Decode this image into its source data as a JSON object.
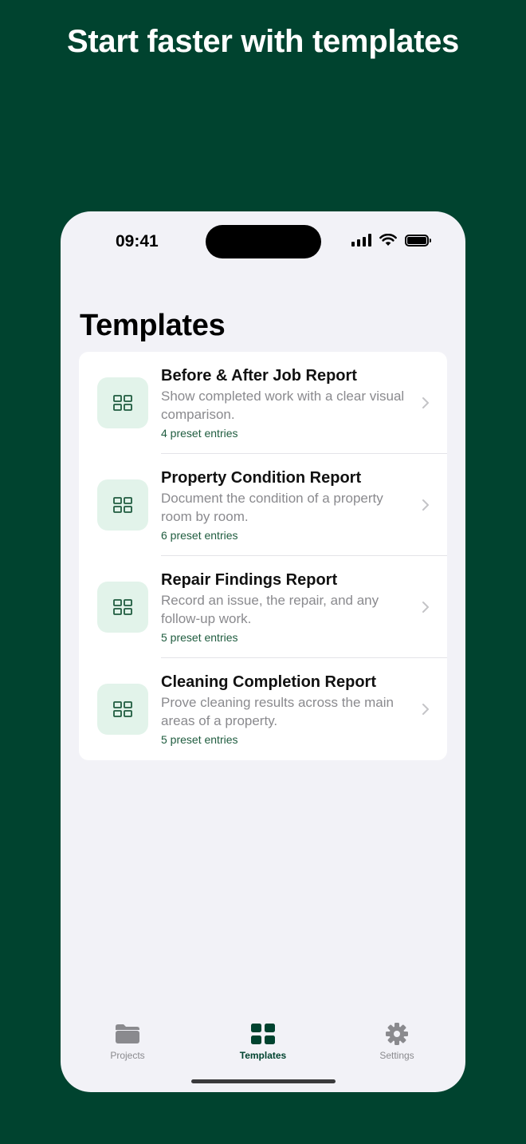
{
  "headline": "Start faster with templates",
  "status_bar": {
    "time": "09:41"
  },
  "page_title": "Templates",
  "templates": [
    {
      "title": "Before & After Job Report",
      "description": "Show completed work with a clear visual comparison.",
      "count": "4 preset entries"
    },
    {
      "title": "Property Condition Report",
      "description": "Document the condition of a property room by room.",
      "count": "6 preset entries"
    },
    {
      "title": "Repair Findings Report",
      "description": "Record an issue, the repair, and any follow-up work.",
      "count": "5 preset entries"
    },
    {
      "title": "Cleaning Completion Report",
      "description": "Prove cleaning results across the main areas of a property.",
      "count": "5 preset entries"
    }
  ],
  "tabs": [
    {
      "label": "Projects",
      "icon": "folder-icon",
      "active": false
    },
    {
      "label": "Templates",
      "icon": "grid-icon",
      "active": true
    },
    {
      "label": "Settings",
      "icon": "gear-icon",
      "active": false
    }
  ],
  "colors": {
    "background": "#00432F",
    "accent": "#00432F",
    "icon_tile": "#E2F3EA",
    "count_text": "#1F5C3F"
  }
}
